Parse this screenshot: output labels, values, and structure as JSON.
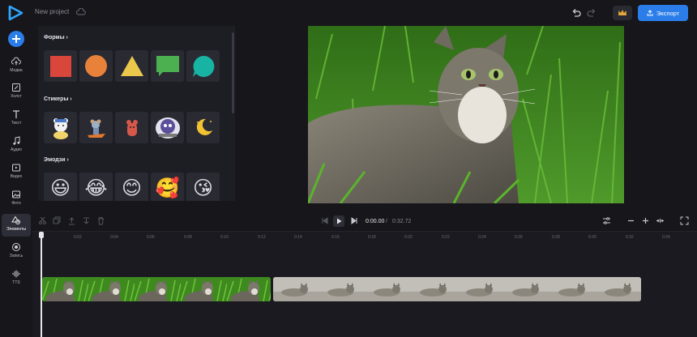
{
  "header": {
    "project_name": "New project",
    "export_label": "Экспорт",
    "accent": "#2b7de9"
  },
  "sidebar": {
    "items": [
      {
        "label": "Медиа",
        "icon": "cloud-upload-icon"
      },
      {
        "label": "Холст",
        "icon": "canvas-icon"
      },
      {
        "label": "Текст",
        "icon": "text-icon"
      },
      {
        "label": "Аудио",
        "icon": "music-note-icon"
      },
      {
        "label": "Видео",
        "icon": "video-icon"
      },
      {
        "label": "Фото",
        "icon": "image-icon"
      },
      {
        "label": "Элементы",
        "icon": "shapes-icon",
        "active": true
      },
      {
        "label": "Запись",
        "icon": "record-icon"
      },
      {
        "label": "TTS",
        "icon": "waveform-icon"
      }
    ]
  },
  "panel": {
    "shapes_title": "Формы",
    "stickers_title": "Стикеры",
    "emoji_title": "Эмодзи",
    "shapes": [
      {
        "name": "square",
        "color": "#d9473c"
      },
      {
        "name": "circle",
        "color": "#e8823a"
      },
      {
        "name": "triangle",
        "color": "#e9c84c"
      },
      {
        "name": "speech-bubble",
        "color": "#4caf50"
      },
      {
        "name": "round-bubble",
        "color": "#17b3a3"
      }
    ],
    "stickers": [
      "bear-sticker",
      "mouse-sticker",
      "fox-sticker",
      "party-sticker",
      "moon-sticker"
    ],
    "emojis": [
      "😃",
      "😂",
      "😊",
      "🥰",
      "😘"
    ]
  },
  "timeline": {
    "current_time": "0:00.00",
    "separator": "/",
    "total_time": "0:32.72",
    "ticks": [
      "0",
      "0:02",
      "0:04",
      "0:06",
      "0:08",
      "0:10",
      "0:12",
      "0:14",
      "0:16",
      "0:18",
      "0:20",
      "0:22",
      "0:24",
      "0:26",
      "0:28",
      "0:30",
      "0:32",
      "0:34"
    ]
  }
}
